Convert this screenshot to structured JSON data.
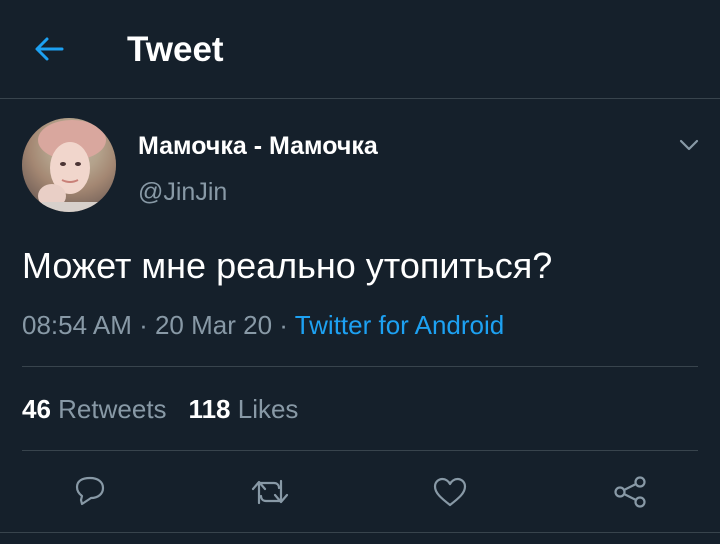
{
  "header": {
    "title": "Tweet",
    "back_icon": "arrow-left-icon"
  },
  "tweet": {
    "display_name": "Мамочка - Мамочка",
    "handle": "@JinJin",
    "text": "Может мне реально утопиться?",
    "time": "08:54 AM",
    "separator": " · ",
    "date": "20 Mar 20",
    "source": "Twitter for Android",
    "retweets_count": "46",
    "retweets_label": "Retweets",
    "likes_count": "118",
    "likes_label": "Likes"
  },
  "actions": [
    "reply-icon",
    "retweet-icon",
    "like-icon",
    "share-icon"
  ],
  "colors": {
    "background": "#15202b",
    "accent": "#1da1f2",
    "secondary_text": "#8899a6",
    "divider": "#38444d"
  }
}
